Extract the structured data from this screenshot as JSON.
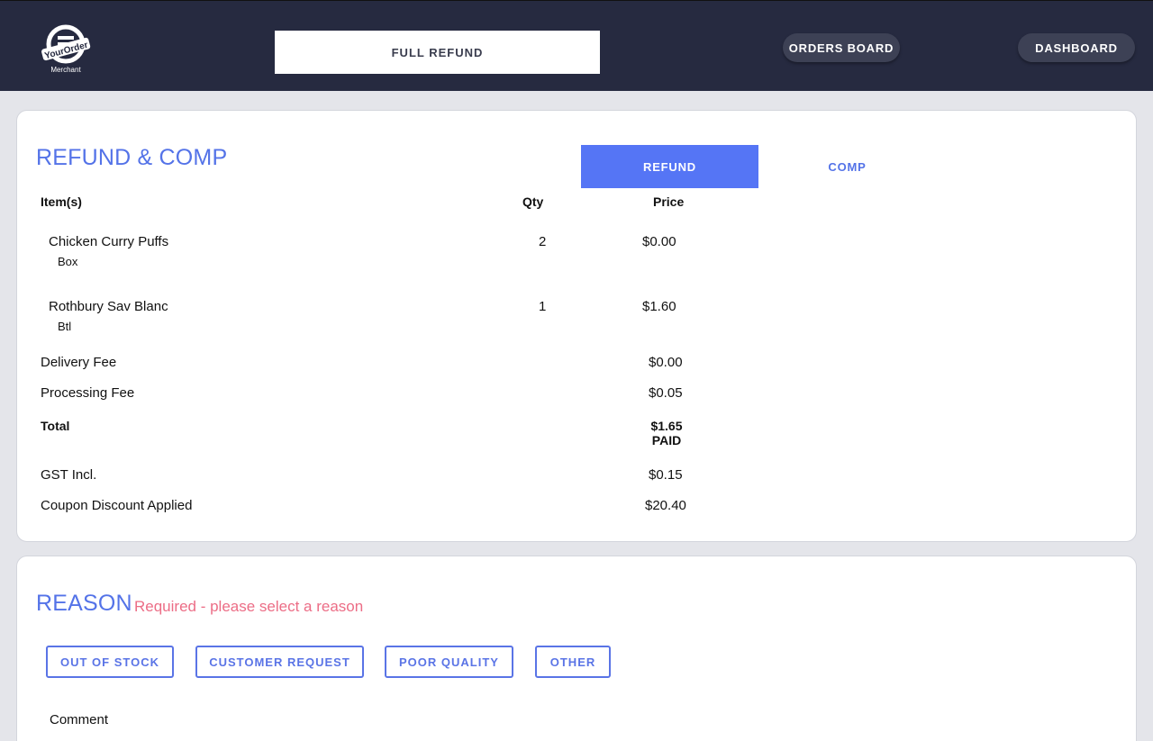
{
  "header": {
    "logo_text": "YourOrder",
    "logo_sub": "Merchant",
    "full_refund": "FULL REFUND",
    "orders_board": "ORDERS BOARD",
    "dashboard": "DASHBOARD"
  },
  "refund_card": {
    "title": "REFUND & COMP",
    "tabs": [
      {
        "label": "REFUND",
        "active": true
      },
      {
        "label": "COMP",
        "active": false
      }
    ],
    "columns": {
      "items": "Item(s)",
      "qty": "Qty",
      "price": "Price"
    },
    "items": [
      {
        "name": "Chicken Curry Puffs",
        "variant": "Box",
        "qty": "2",
        "price": "$0.00"
      },
      {
        "name": "Rothbury Sav Blanc",
        "variant": "Btl",
        "qty": "1",
        "price": "$1.60"
      }
    ],
    "summary": {
      "delivery_label": "Delivery Fee",
      "delivery_value": "$0.00",
      "processing_label": "Processing Fee",
      "processing_value": "$0.05",
      "total_label": "Total",
      "total_value": "$1.65",
      "total_status": "PAID",
      "gst_label": "GST Incl.",
      "gst_value": "$0.15",
      "coupon_label": "Coupon Discount Applied",
      "coupon_value": "$20.40"
    }
  },
  "reason_card": {
    "title": "REASON",
    "required_note": "Required - please select a reason",
    "options": [
      "OUT OF STOCK",
      "CUSTOMER REQUEST",
      "POOR QUALITY",
      "OTHER"
    ],
    "comment_label": "Comment"
  },
  "colors": {
    "header_bg": "#262a40",
    "accent": "#5473e8",
    "tab_active": "#5575f5",
    "warning": "#ec6d86",
    "page_bg": "#e4e5ea"
  }
}
